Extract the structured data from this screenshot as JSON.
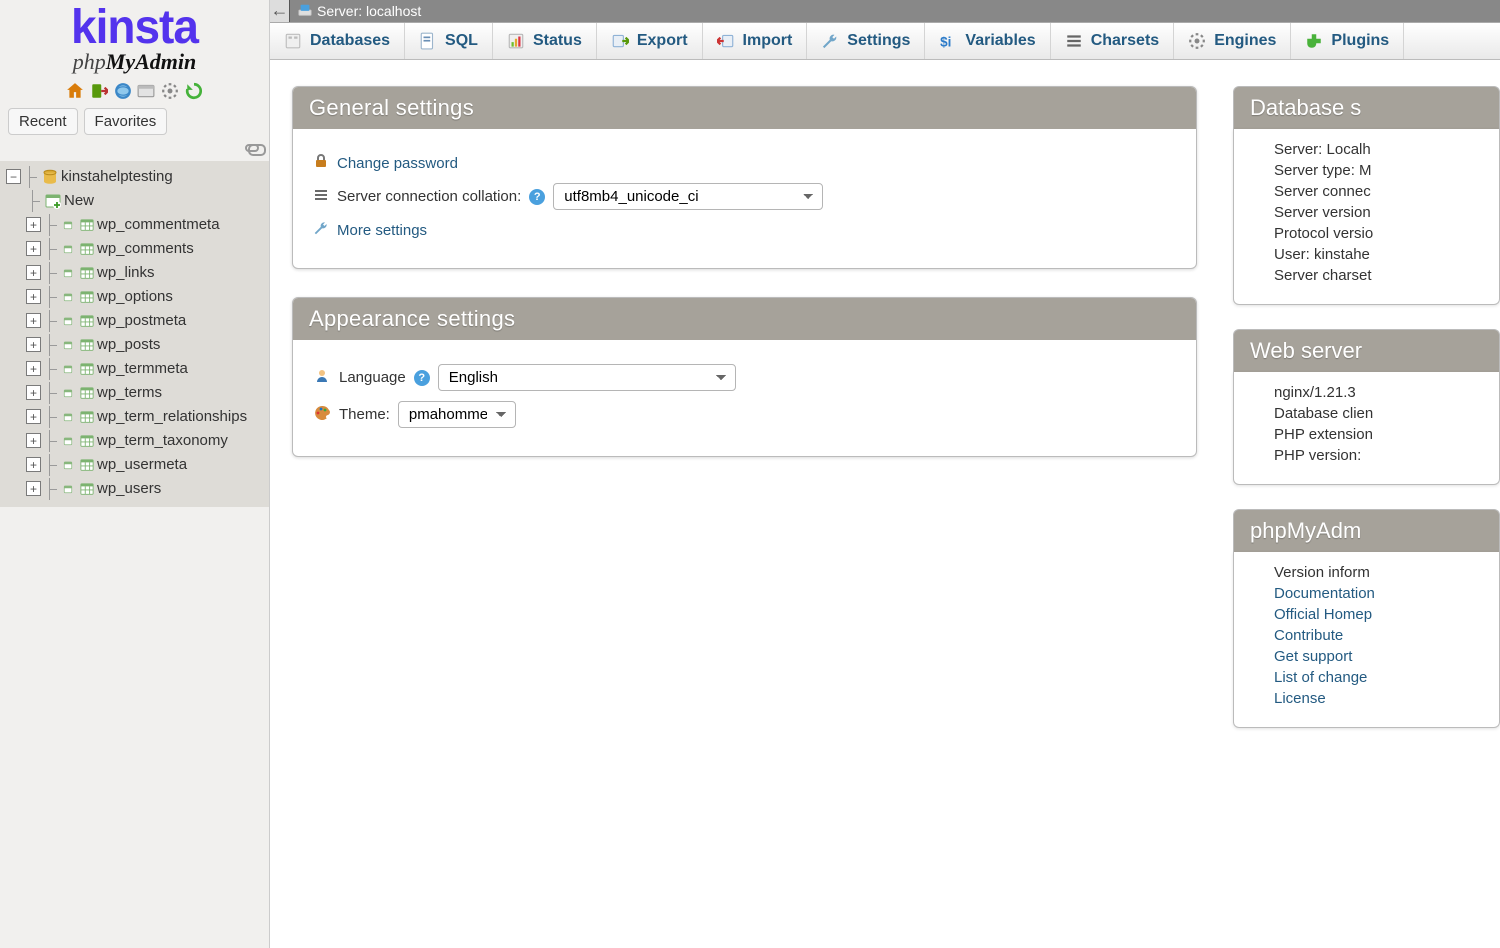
{
  "logo": {
    "brand": "kinsta",
    "product_html": "phpMyAdmin"
  },
  "sidebar_tabs": {
    "recent": "Recent",
    "favorites": "Favorites"
  },
  "tree": {
    "database": "kinstahelptesting",
    "new_label": "New",
    "tables": [
      "wp_commentmeta",
      "wp_comments",
      "wp_links",
      "wp_options",
      "wp_postmeta",
      "wp_posts",
      "wp_termmeta",
      "wp_terms",
      "wp_term_relationships",
      "wp_term_taxonomy",
      "wp_usermeta",
      "wp_users"
    ]
  },
  "breadcrumb": {
    "label": "Server: localhost"
  },
  "tabs": [
    {
      "key": "databases",
      "label": "Databases"
    },
    {
      "key": "sql",
      "label": "SQL"
    },
    {
      "key": "status",
      "label": "Status"
    },
    {
      "key": "export",
      "label": "Export"
    },
    {
      "key": "import",
      "label": "Import"
    },
    {
      "key": "settings",
      "label": "Settings"
    },
    {
      "key": "variables",
      "label": "Variables"
    },
    {
      "key": "charsets",
      "label": "Charsets"
    },
    {
      "key": "engines",
      "label": "Engines"
    },
    {
      "key": "plugins",
      "label": "Plugins"
    }
  ],
  "general": {
    "title": "General settings",
    "change_password": "Change password",
    "collation_label": "Server connection collation:",
    "collation_value": "utf8mb4_unicode_ci",
    "more": "More settings"
  },
  "appearance": {
    "title": "Appearance settings",
    "language_label": "Language",
    "language_value": "English",
    "theme_label": "Theme:",
    "theme_value": "pmahomme"
  },
  "right": {
    "db_server": {
      "title": "Database s",
      "items": [
        "Server: Localh",
        "Server type: M",
        "Server connec",
        "Server version",
        "Protocol versio",
        "User: kinstahe",
        "Server charset"
      ]
    },
    "web_server": {
      "title": "Web server",
      "items": [
        "nginx/1.21.3",
        "Database clien",
        "PHP extension",
        "PHP version: "
      ]
    },
    "pma": {
      "title": "phpMyAdm",
      "items_text": [
        "Version inform"
      ],
      "items_link": [
        "Documentation",
        "Official Homep",
        "Contribute",
        "Get support",
        "List of change",
        "License"
      ]
    }
  }
}
